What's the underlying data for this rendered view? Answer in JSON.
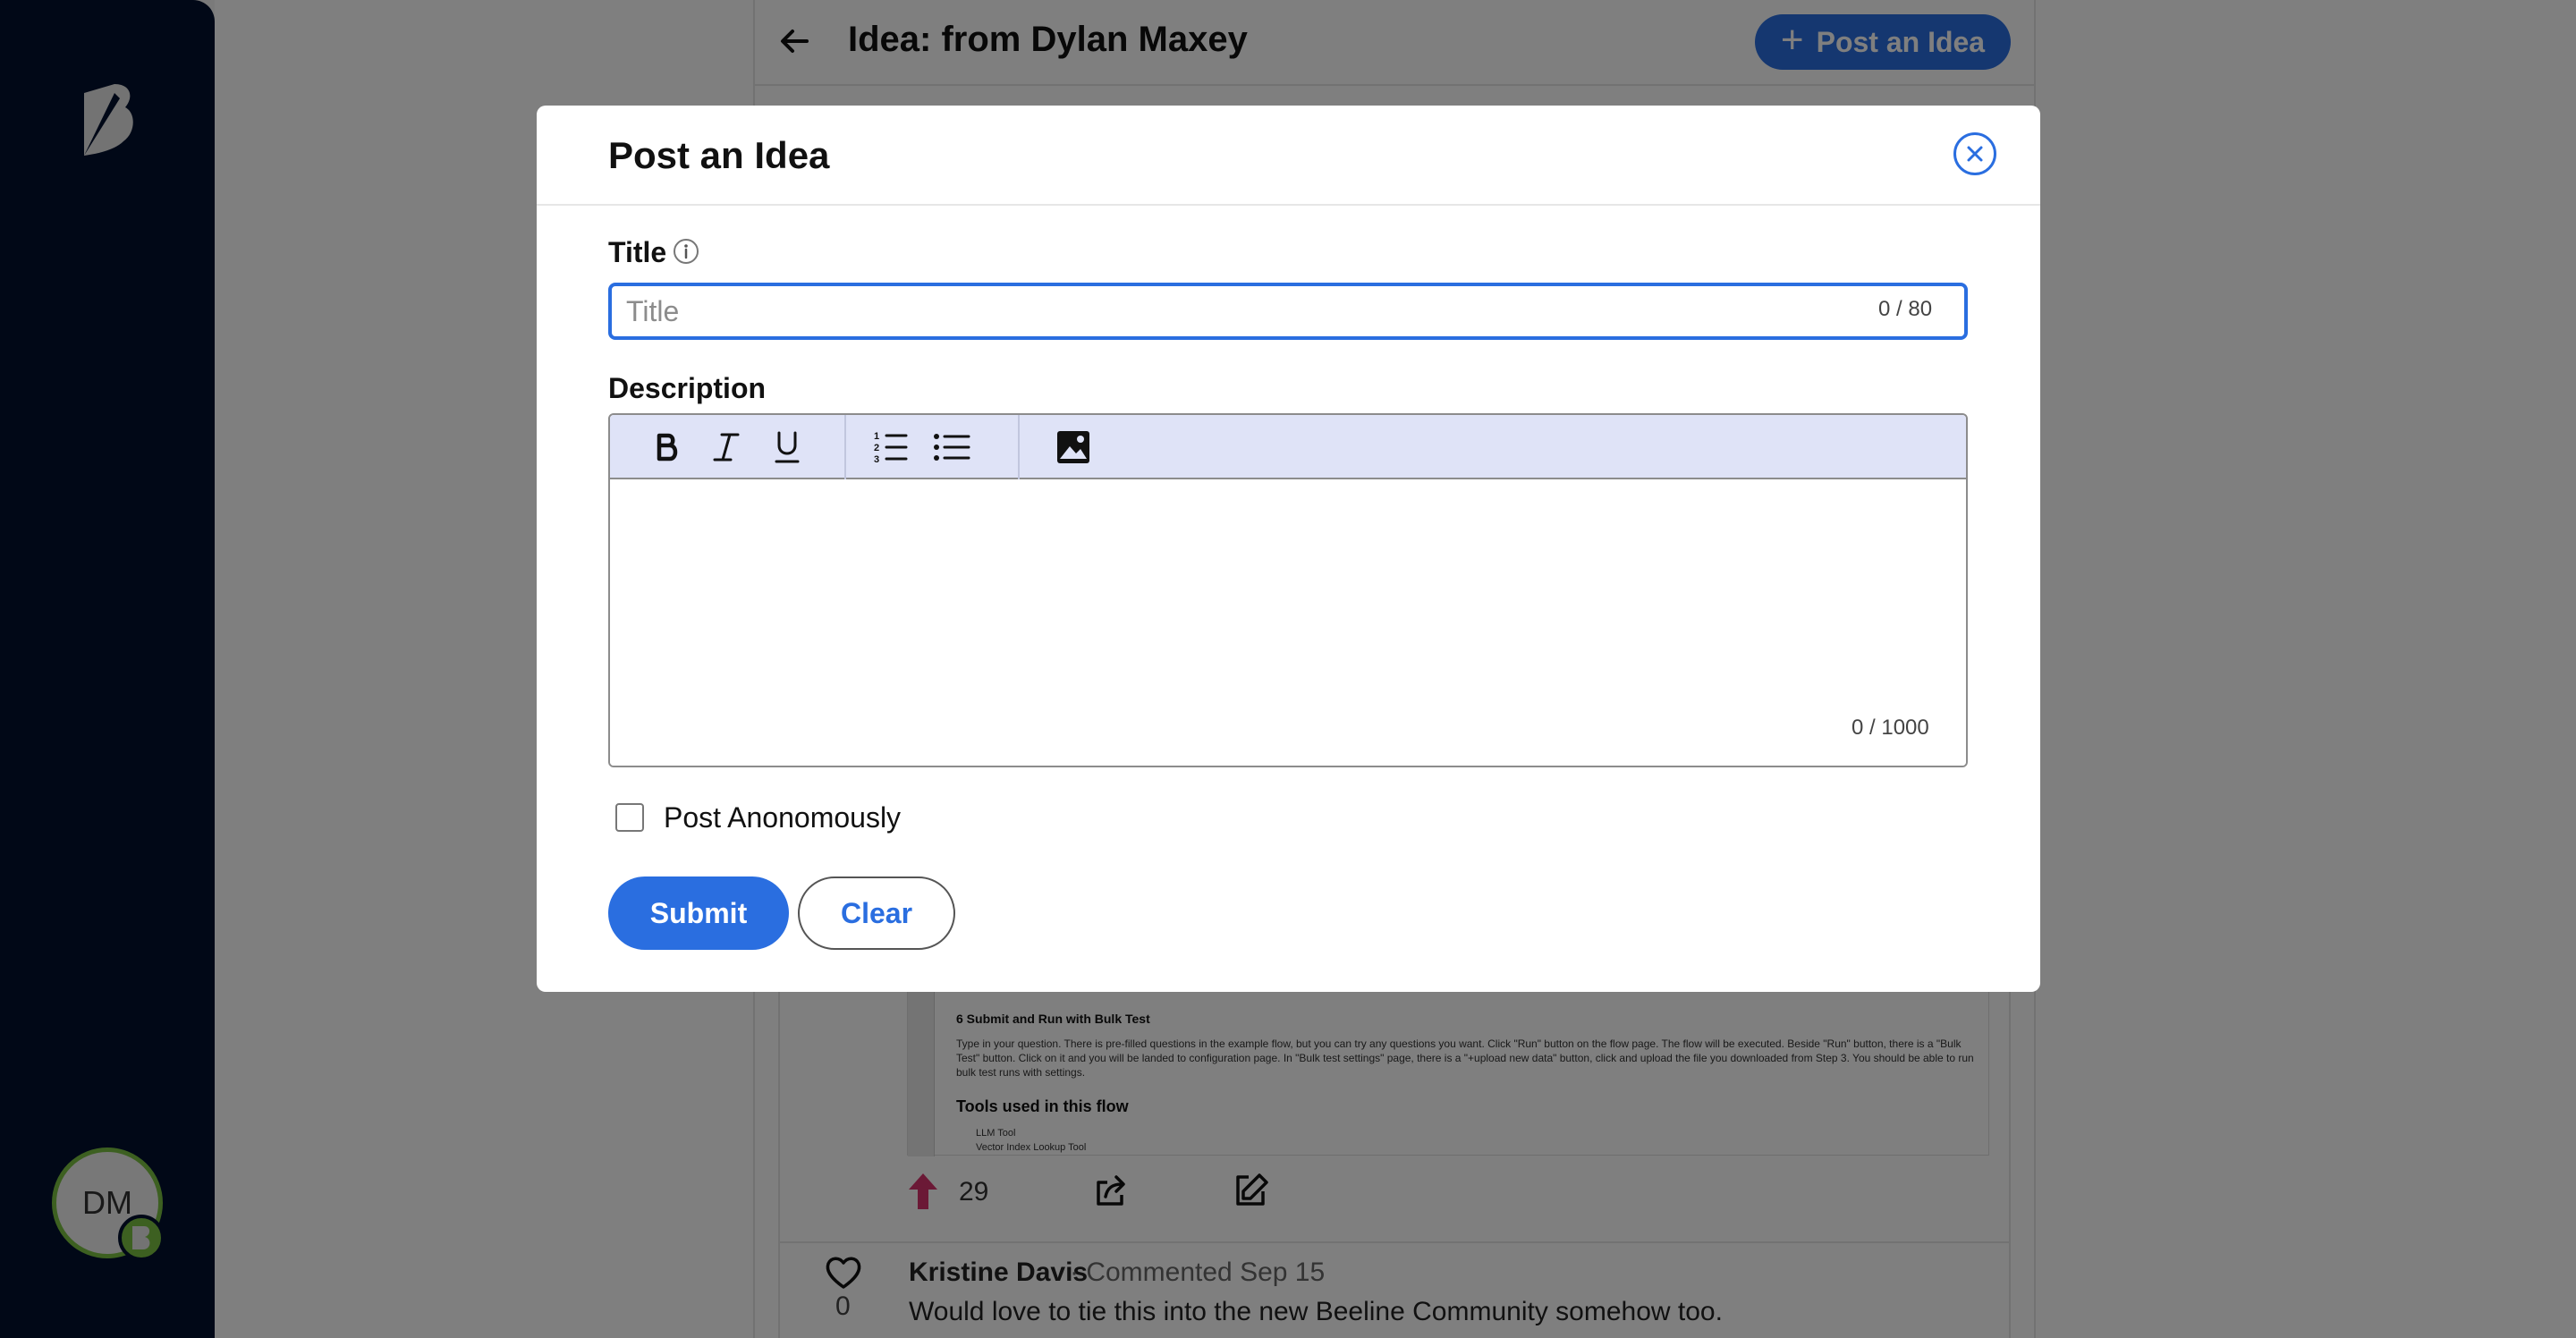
{
  "sidebar": {
    "avatar_initials": "DM"
  },
  "page": {
    "title": "Idea: from Dylan Maxey",
    "post_idea_label": "Post an Idea",
    "screenshot": {
      "heading": "6 Submit and Run with Bulk Test",
      "paragraph": "Type in your question. There is pre-filled questions in the example flow, but you can try any questions you want. Click \"Run\" button on the flow page. The flow will be executed. Beside \"Run\" button, there is a \"Bulk Test\" button. Click on it and you will be landed to configuration page. In \"Bulk test settings\" page, there is a \"+upload new data\" button, click and upload the file you downloaded from Step 3. You should be able to run bulk test runs with settings.",
      "tools_heading": "Tools used in this flow",
      "tools": [
        "LLM Tool",
        "Vector Index Lookup Tool"
      ]
    },
    "vote_count": "29",
    "comment": {
      "author": "Kristine Davis",
      "meta": "· Commented Sep 15",
      "text": "Would love to tie this into the new Beeline Community somehow too.",
      "like_count": "0"
    }
  },
  "modal": {
    "title": "Post an Idea",
    "title_label": "Title",
    "title_placeholder": "Title",
    "title_value": "",
    "title_counter": "0 / 80",
    "description_label": "Description",
    "description_counter": "0 / 1000",
    "anonymous_label": "Post Anonomously",
    "anonymous_checked": false,
    "submit_label": "Submit",
    "clear_label": "Clear"
  },
  "colors": {
    "accent": "#2a6ee0",
    "sidebar": "#03112e",
    "toolbar": "#dfe3f7",
    "avatar_ring": "#7ac142",
    "upvote": "#d6336c"
  },
  "icons": {
    "back": "arrow-left-icon",
    "add": "plus-icon",
    "close": "close-icon",
    "info": "info-icon",
    "bold": "bold-icon",
    "italic": "italic-icon",
    "underline": "underline-icon",
    "ordered_list": "ordered-list-icon",
    "bullet_list": "bullet-list-icon",
    "image": "image-icon",
    "upvote": "upvote-arrow-icon",
    "share": "share-icon",
    "edit": "edit-icon",
    "like": "heart-icon"
  }
}
